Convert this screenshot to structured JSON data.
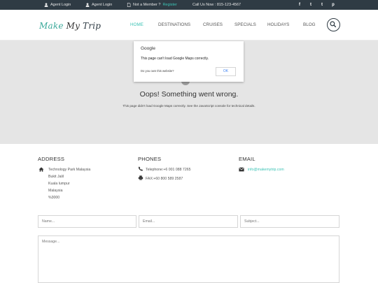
{
  "topbar": {
    "agent_login_1": "Agent Login",
    "agent_login_2": "Agent Login",
    "not_member": "Not a Member ?",
    "register": "Register",
    "call_us": "Call Us Now : 815-123-4567",
    "social": [
      "f",
      "t",
      "t",
      "p"
    ]
  },
  "header": {
    "logo": {
      "make": "Make",
      "my": "My",
      "trip": "Trip"
    },
    "nav": [
      "HOME",
      "DESTINATIONS",
      "CRUISES",
      "SPECIALS",
      "HOLIDAYS",
      "BLOG"
    ]
  },
  "map": {
    "dialog_title": "Google",
    "dialog_message": "This page can't load Google Maps correctly.",
    "dialog_question": "Do you own this website?",
    "dialog_ok": "OK",
    "oops": "Oops! Something went wrong.",
    "detail": "This page didn't load Google Maps correctly. See the JavaScript console for technical details."
  },
  "contact": {
    "address_heading": "ADDRESS",
    "address_lines": [
      "Technology Park Malaysia",
      "Bukit Jalil",
      "Kuala lumpur",
      "Malaysia",
      "%3000"
    ],
    "phones_heading": "PHONES",
    "telephone": "Telephone:+6 001 088 7265",
    "fax": "FAX:+60 800 589 2587",
    "email_heading": "EMAIL",
    "email": "info@makemytrip.com"
  },
  "form": {
    "name_placeholder": "Name...",
    "email_placeholder": "Email...",
    "subject_placeholder": "Subject...",
    "message_placeholder": "Message..."
  }
}
